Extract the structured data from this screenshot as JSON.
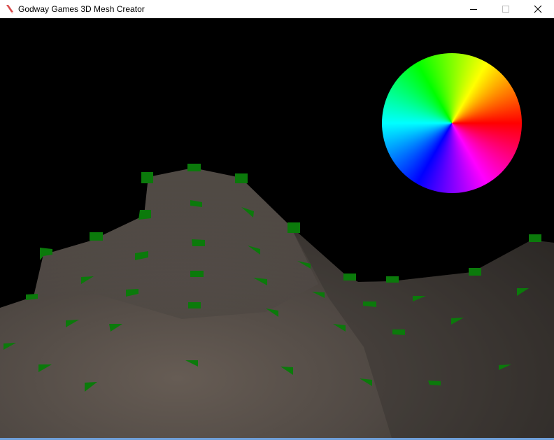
{
  "window": {
    "title": "Godway Games 3D Mesh Creator",
    "controls": {
      "minimize": "minimize-icon",
      "maximize": "maximize-icon",
      "close": "close-icon"
    }
  },
  "scene": {
    "background": "#000000",
    "terrain_color": "#57504a",
    "marker_color": "#0b7a0b",
    "has_color_wheel": true
  }
}
